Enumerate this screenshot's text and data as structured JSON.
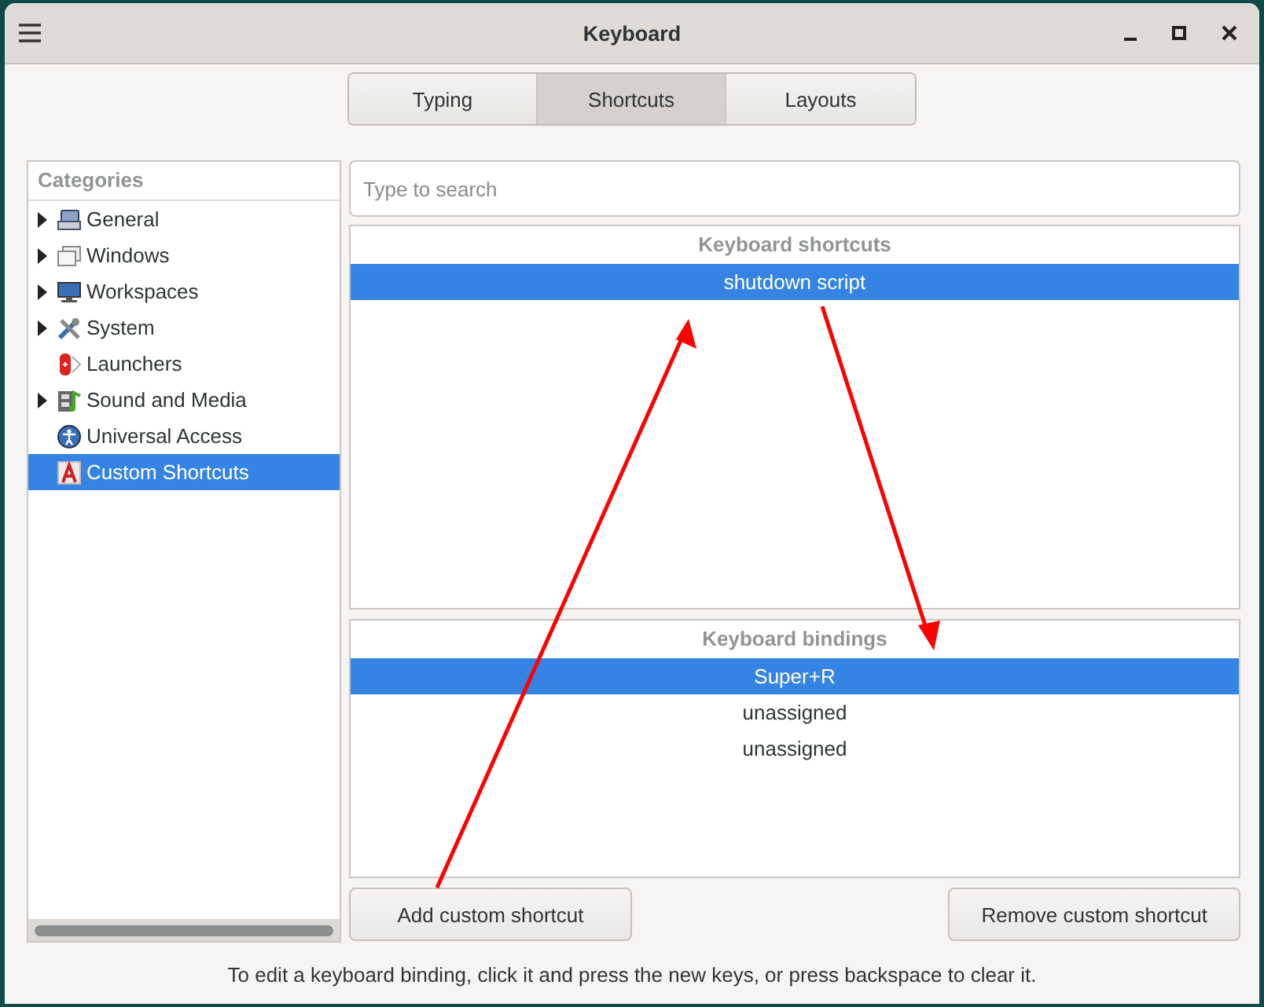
{
  "window": {
    "title": "Keyboard"
  },
  "tabs": [
    {
      "label": "Typing",
      "selected": false
    },
    {
      "label": "Shortcuts",
      "selected": true
    },
    {
      "label": "Layouts",
      "selected": false
    }
  ],
  "categories": {
    "heading": "Categories",
    "items": [
      {
        "label": "General",
        "expandable": true,
        "selected": false
      },
      {
        "label": "Windows",
        "expandable": true,
        "selected": false
      },
      {
        "label": "Workspaces",
        "expandable": true,
        "selected": false
      },
      {
        "label": "System",
        "expandable": true,
        "selected": false
      },
      {
        "label": "Launchers",
        "expandable": false,
        "selected": false
      },
      {
        "label": "Sound and Media",
        "expandable": true,
        "selected": false
      },
      {
        "label": "Universal Access",
        "expandable": false,
        "selected": false
      },
      {
        "label": "Custom Shortcuts",
        "expandable": false,
        "selected": true
      }
    ]
  },
  "search": {
    "placeholder": "Type to search"
  },
  "shortcuts": {
    "heading": "Keyboard shortcuts",
    "rows": [
      {
        "label": "shutdown script",
        "selected": true
      }
    ]
  },
  "bindings": {
    "heading": "Keyboard bindings",
    "rows": [
      {
        "label": "Super+R",
        "selected": true
      },
      {
        "label": "unassigned",
        "selected": false
      },
      {
        "label": "unassigned",
        "selected": false
      }
    ]
  },
  "buttons": [
    "Add custom shortcut",
    "Remove custom shortcut"
  ],
  "hint": "To edit a keyboard binding, click it and press the new keys, or press backspace to clear it."
}
